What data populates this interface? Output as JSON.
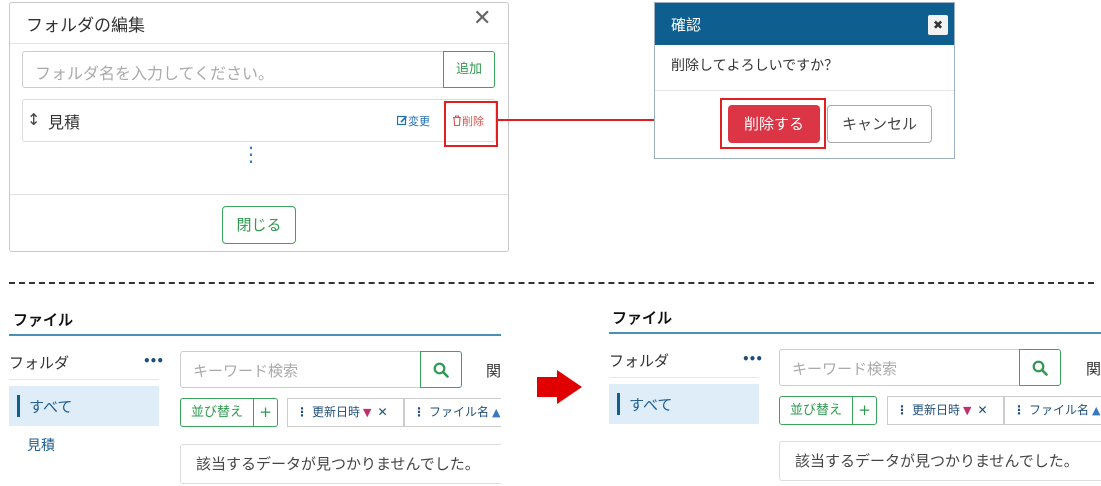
{
  "folder_dialog": {
    "title": "フォルダの編集",
    "close_glyph": "✕",
    "input_placeholder": "フォルダ名を入力してください。",
    "add_label": "追加",
    "row": {
      "grip_glyph": "↕",
      "name": "見積",
      "edit_label": "変更",
      "delete_label": "削除"
    },
    "more_glyph": "⋮",
    "close_label": "閉じる"
  },
  "confirm_dialog": {
    "title": "確認",
    "close_glyph": "✖",
    "message": "削除してよろしいですか？",
    "delete_label": "削除する",
    "cancel_label": "キャンセル"
  },
  "panel_before": {
    "title": "ファイル",
    "folder_header": "フォルダ",
    "more_glyph": "•••",
    "folders": [
      "すべて",
      "見積"
    ],
    "search_placeholder": "キーワード検索",
    "search_tail": "関",
    "sort_label": "並び替え",
    "add_sort_glyph": "+",
    "sort_chips": [
      {
        "label": "更新日時",
        "direction": "desc"
      },
      {
        "label": "ファイル名",
        "direction": "asc"
      }
    ],
    "empty_message": "該当するデータが見つかりませんでした。"
  },
  "panel_after": {
    "title": "ファイル",
    "folder_header": "フォルダ",
    "more_glyph": "•••",
    "folders": [
      "すべて"
    ],
    "search_placeholder": "キーワード検索",
    "search_tail": "関",
    "sort_label": "並び替え",
    "add_sort_glyph": "+",
    "sort_chips": [
      {
        "label": "更新日時",
        "direction": "desc"
      },
      {
        "label": "ファイル名",
        "direction": "asc"
      }
    ],
    "empty_message": "該当するデータが見つかりませんでした。"
  },
  "colors": {
    "header_blue": "#0e5f8f",
    "success_green": "#3aa55b",
    "danger_red": "#dc3545",
    "highlight_red": "#e02020",
    "selected_bg": "#deedf7"
  }
}
